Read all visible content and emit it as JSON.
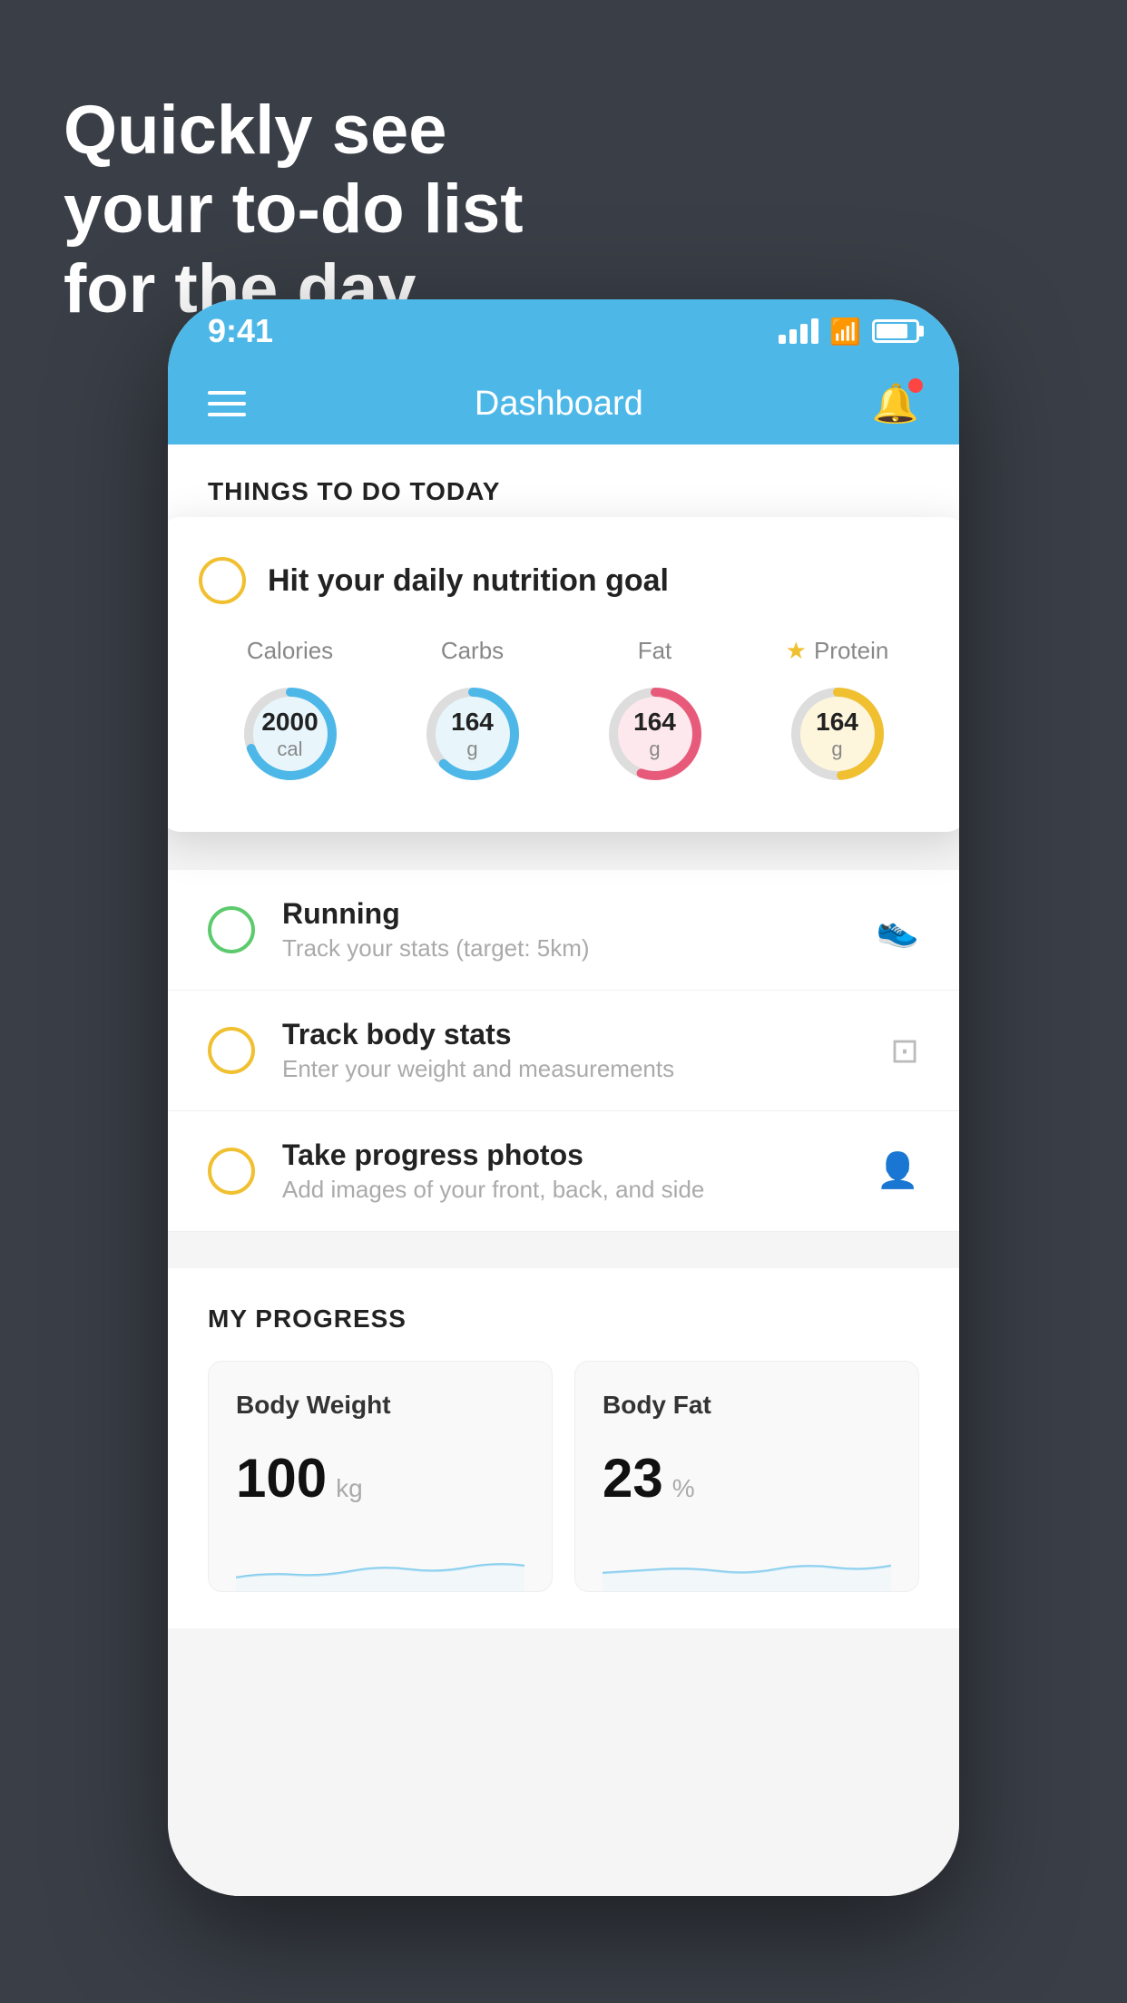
{
  "background": {
    "headline_line1": "Quickly see",
    "headline_line2": "your to-do list",
    "headline_line3": "for the day."
  },
  "phone": {
    "status_bar": {
      "time": "9:41"
    },
    "nav": {
      "title": "Dashboard"
    },
    "things_section": {
      "title": "THINGS TO DO TODAY"
    },
    "nutrition_card": {
      "title": "Hit your daily nutrition goal",
      "macros": [
        {
          "label": "Calories",
          "value": "2000",
          "unit": "cal",
          "color": "#4db8e8",
          "bg": "#e8f6fc",
          "starred": false
        },
        {
          "label": "Carbs",
          "value": "164",
          "unit": "g",
          "color": "#4db8e8",
          "bg": "#e8f6fc",
          "starred": false
        },
        {
          "label": "Fat",
          "value": "164",
          "unit": "g",
          "color": "#e85a7a",
          "bg": "#fce8ed",
          "starred": false
        },
        {
          "label": "Protein",
          "value": "164",
          "unit": "g",
          "color": "#f0c030",
          "bg": "#fdf5dc",
          "starred": true
        }
      ]
    },
    "todo_items": [
      {
        "name": "Running",
        "sub": "Track your stats (target: 5km)",
        "circle_color": "green",
        "icon": "👟"
      },
      {
        "name": "Track body stats",
        "sub": "Enter your weight and measurements",
        "circle_color": "yellow",
        "icon": "⚖️"
      },
      {
        "name": "Take progress photos",
        "sub": "Add images of your front, back, and side",
        "circle_color": "yellow",
        "icon": "👤"
      }
    ],
    "progress_section": {
      "title": "MY PROGRESS",
      "cards": [
        {
          "title": "Body Weight",
          "value": "100",
          "unit": "kg"
        },
        {
          "title": "Body Fat",
          "value": "23",
          "unit": "%"
        }
      ]
    }
  }
}
